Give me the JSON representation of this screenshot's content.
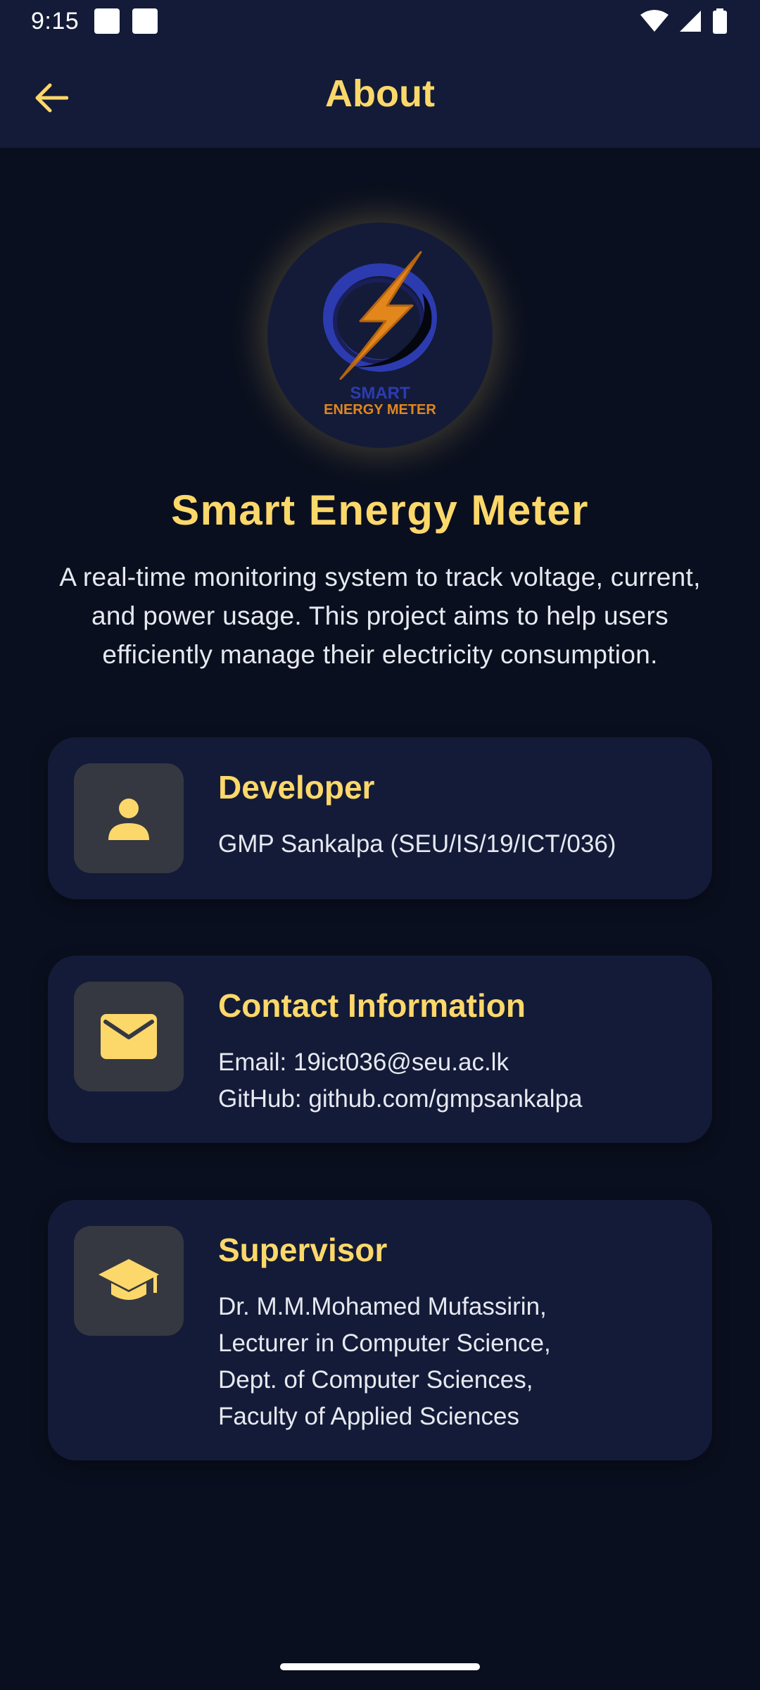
{
  "status_bar": {
    "time": "9:15"
  },
  "app_bar": {
    "title": "About"
  },
  "logo": {
    "line1": "SMART",
    "line2": "ENERGY METER"
  },
  "app": {
    "name": "Smart Energy Meter",
    "description_lines": [
      "A real-time monitoring system to track voltage, current,",
      "and power usage. This project aims to help users",
      "efficiently manage their electricity consumption."
    ]
  },
  "cards": {
    "developer": {
      "title": "Developer",
      "lines": [
        "GMP Sankalpa (SEU/IS/19/ICT/036)"
      ],
      "icon": "person-icon"
    },
    "contact": {
      "title": "Contact Information",
      "lines": [
        "Email: 19ict036@seu.ac.lk",
        "GitHub: github.com/gmpsankalpa"
      ],
      "icon": "mail-icon"
    },
    "supervisor": {
      "title": "Supervisor",
      "lines": [
        "Dr. M.M.Mohamed Mufassirin,",
        "Lecturer in Computer Science,",
        "Dept. of Computer Sciences,",
        "Faculty of Applied Sciences"
      ],
      "icon": "graduation-cap-icon"
    }
  },
  "colors": {
    "accent": "#fcd86a",
    "background": "#0a0f1f",
    "surface": "#131b38",
    "icon_box": "#353841"
  }
}
